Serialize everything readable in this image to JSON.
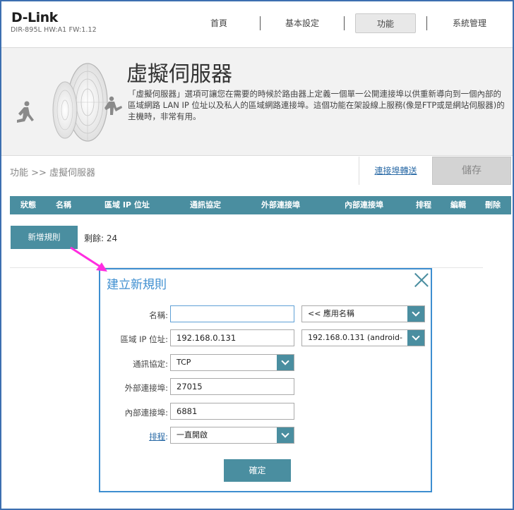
{
  "header": {
    "logo": "D-Link",
    "model": "DIR-895L HW:A1 FW:1.12",
    "nav": [
      {
        "label": "首頁"
      },
      {
        "label": "基本設定"
      },
      {
        "label": "功能"
      },
      {
        "label": "系統管理"
      }
    ]
  },
  "banner": {
    "title": "虛擬伺服器",
    "description": "「虛擬伺服器」選項可讓您在需要的時候於路由器上定義一個單一公開連接埠以供重新導向到一個內部的區域網路 LAN IP 位址以及私人的區域網路連接埠。這個功能在架設線上服務(像是FTP或是網站伺服器)的主機時，非常有用。"
  },
  "breadcrumb": "功能 >> 虛擬伺服器",
  "toolbar": {
    "port_forward_link": "連接埠轉送",
    "save_label": "儲存"
  },
  "table": {
    "columns": [
      "狀態",
      "名稱",
      "區域 IP 位址",
      "通訊協定",
      "外部連接埠",
      "內部連接埠",
      "排程",
      "編輯",
      "刪除"
    ]
  },
  "add_rule": {
    "button_label": "新增規則",
    "remaining": "剩餘: 24"
  },
  "modal": {
    "title": "建立新規則",
    "fields": {
      "name_label": "名稱:",
      "name_value": "",
      "app_select": "<< 應用名稱",
      "ip_label": "區域 IP 位址:",
      "ip_value": "192.168.0.131",
      "ip_select": "192.168.0.131 (android-",
      "protocol_label": "通訊協定:",
      "protocol_value": "TCP",
      "ext_port_label": "外部連接埠:",
      "ext_port_value": "27015",
      "int_port_label": "內部連接埠:",
      "int_port_value": "6881",
      "schedule_label": "排程",
      "schedule_colon": ":",
      "schedule_value": "一直開啟"
    },
    "ok_label": "確定"
  },
  "colors": {
    "accent": "#4a8ea0",
    "modal_border": "#3d8ed0",
    "link": "#2a6aa6",
    "arrow": "#ff2de0"
  }
}
